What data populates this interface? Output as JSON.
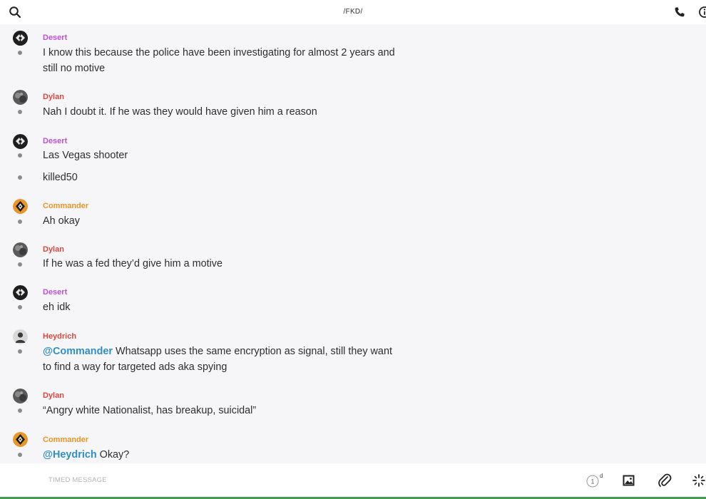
{
  "header": {
    "title": "/FKD/"
  },
  "colors": {
    "desert": "#c050d8",
    "dylan": "#d9473f",
    "commander": "#e8952a",
    "heydrich": "#d9473f",
    "mention": "#2f8fc8"
  },
  "messages": [
    {
      "sender": "Desert",
      "text": "I know this because the police have been investigating for almost 2 years and still no motive"
    },
    {
      "sender": "Dylan",
      "text": "Nah I doubt it. If he was they would have given him a reason"
    },
    {
      "sender": "Desert",
      "text": "Las Vegas shooter"
    },
    {
      "text": "killed50"
    },
    {
      "sender": "Commander",
      "text": "Ah okay"
    },
    {
      "sender": "Dylan",
      "text": "If he was a fed they’d give him a motive"
    },
    {
      "sender": "Desert",
      "text": "eh idk"
    },
    {
      "sender": "Heydrich",
      "mention": "@Commander",
      "text": " Whatsapp uses the same encryption as signal, still they want to find a way for targeted ads aka spying"
    },
    {
      "sender": "Dylan",
      "text": "“Angry white Nationalist, has breakup, suicidal”"
    },
    {
      "sender": "Commander",
      "mention": "@Heydrich",
      "text": " Okay?"
    }
  ],
  "composer": {
    "placeholder": "TIMED MESSAGE",
    "timer_value": "1",
    "timer_unit": "d"
  },
  "icons": {
    "search": "search-icon",
    "phone": "phone-icon",
    "info": "info-icon",
    "timer": "timer-icon",
    "image": "image-icon",
    "attach": "paperclip-icon",
    "more": "sparkle-icon"
  }
}
